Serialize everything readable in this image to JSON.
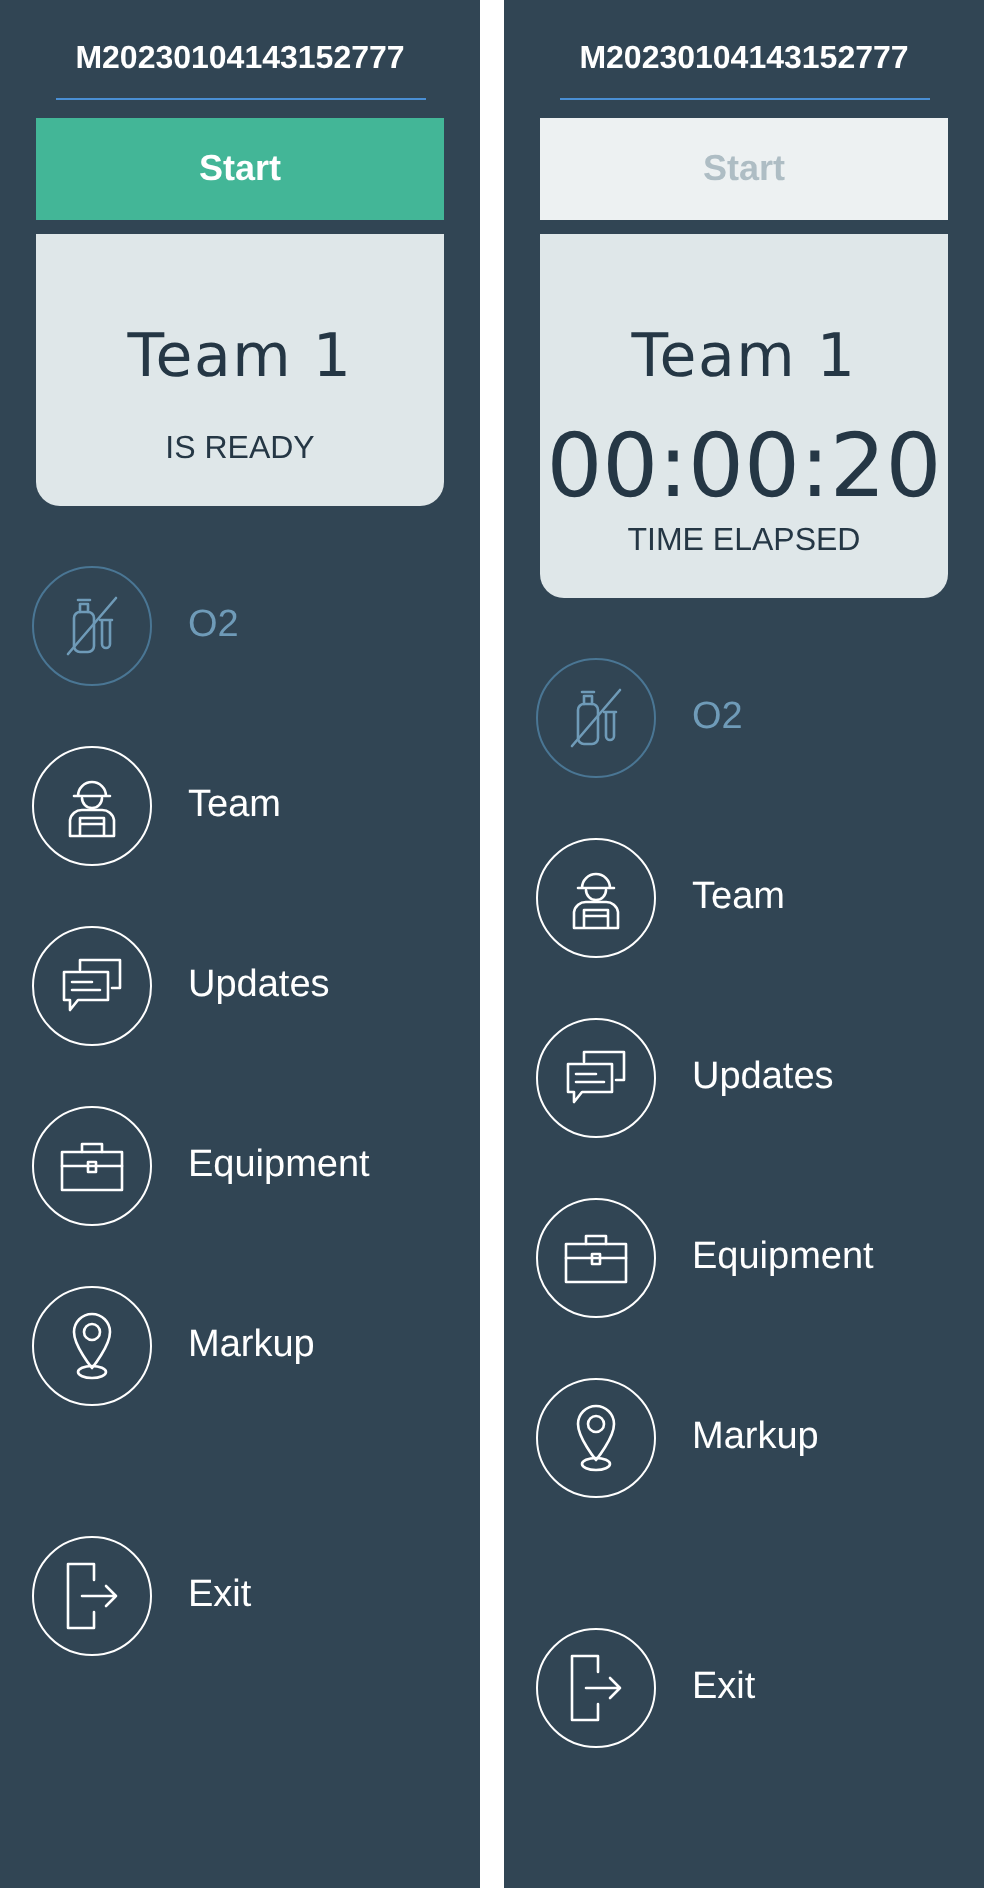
{
  "panels": [
    {
      "mission_id": "M20230104143152777",
      "start_button": {
        "label": "Start",
        "disabled": false
      },
      "team_card": {
        "team": "Team 1",
        "status": "IS READY"
      },
      "menu": [
        {
          "kind": "oxygen",
          "label": "O2",
          "disabled": true
        },
        {
          "kind": "team",
          "label": "Team",
          "disabled": false
        },
        {
          "kind": "updates",
          "label": "Updates",
          "disabled": false
        },
        {
          "kind": "equipment",
          "label": "Equipment",
          "disabled": false
        },
        {
          "kind": "markup",
          "label": "Markup",
          "disabled": false
        },
        {
          "kind": "exit",
          "label": "Exit",
          "disabled": false
        }
      ]
    },
    {
      "mission_id": "M20230104143152777",
      "start_button": {
        "label": "Start",
        "disabled": true
      },
      "team_card": {
        "team": "Team 1",
        "timer": "00:00:20",
        "status": "TIME ELAPSED"
      },
      "menu": [
        {
          "kind": "oxygen",
          "label": "O2",
          "disabled": true
        },
        {
          "kind": "team",
          "label": "Team",
          "disabled": false
        },
        {
          "kind": "updates",
          "label": "Updates",
          "disabled": false
        },
        {
          "kind": "equipment",
          "label": "Equipment",
          "disabled": false
        },
        {
          "kind": "markup",
          "label": "Markup",
          "disabled": false
        },
        {
          "kind": "exit",
          "label": "Exit",
          "disabled": false
        }
      ]
    }
  ]
}
